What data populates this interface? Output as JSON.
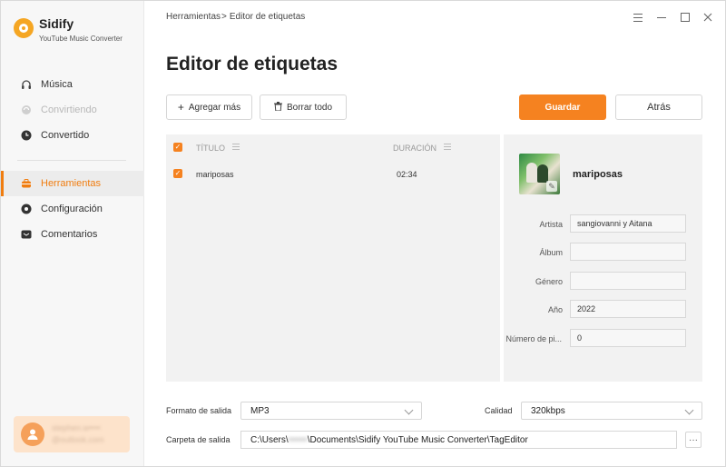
{
  "brand": {
    "name": "Sidify",
    "subtitle": "YouTube Music Converter"
  },
  "sidebar": {
    "items": [
      {
        "label": "Música",
        "icon": "headphones-icon",
        "state": "normal"
      },
      {
        "label": "Convirtiendo",
        "icon": "sync-icon",
        "state": "disabled"
      },
      {
        "label": "Convertido",
        "icon": "clock-icon",
        "state": "normal"
      },
      {
        "label": "Herramientas",
        "icon": "toolbox-icon",
        "state": "active"
      },
      {
        "label": "Configuración",
        "icon": "gear-icon",
        "state": "normal"
      },
      {
        "label": "Comentarios",
        "icon": "mail-icon",
        "state": "normal"
      }
    ],
    "user": {
      "line1": "stephen.w••••",
      "line2": "@outlook.com"
    }
  },
  "header": {
    "breadcrumb_parent": "Herramientas",
    "breadcrumb_separator": ">",
    "breadcrumb_current": "Editor de etiquetas",
    "window_controls": [
      "menu-icon",
      "minimize-icon",
      "maximize-icon",
      "close-icon"
    ]
  },
  "page": {
    "title": "Editor de etiquetas"
  },
  "toolbar": {
    "add_label": "Agregar más",
    "delete_all_label": "Borrar todo",
    "save_label": "Guardar",
    "back_label": "Atrás"
  },
  "table": {
    "col_title": "TÍTULO",
    "col_duration": "DURACIÓN",
    "rows": [
      {
        "title": "mariposas",
        "duration": "02:34",
        "checked": true
      }
    ]
  },
  "details": {
    "song_title": "mariposas",
    "fields": [
      {
        "label": "Artista",
        "value": "sangiovanni y Aitana"
      },
      {
        "label": "Álbum",
        "value": ""
      },
      {
        "label": "Género",
        "value": ""
      },
      {
        "label": "Año",
        "value": "2022"
      },
      {
        "label": "Número de pi...",
        "value": "0"
      }
    ]
  },
  "output": {
    "format_label": "Formato de salida",
    "format_value": "MP3",
    "quality_label": "Calidad",
    "quality_value": "320kbps",
    "folder_label": "Carpeta de salida",
    "folder_prefix": "C:\\Users\\",
    "folder_user": "••••••",
    "folder_suffix": "\\Documents\\Sidify YouTube Music Converter\\TagEditor",
    "browse_label": "···"
  },
  "colors": {
    "accent": "#f58220",
    "sidebar_bg": "#f7f7f7",
    "panel_bg": "#f2f2f2"
  }
}
